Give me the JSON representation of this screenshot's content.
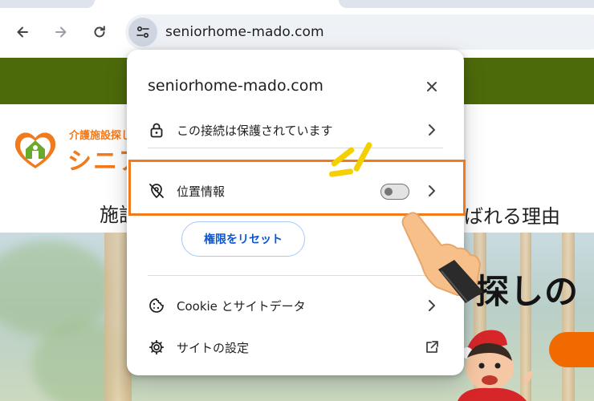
{
  "browser": {
    "url": "seniorhome-mado.com",
    "nav_icons": [
      "back-arrow-icon",
      "forward-arrow-icon",
      "reload-icon",
      "site-info-tune-icon"
    ]
  },
  "page": {
    "logo_subtitle": "介護施設探し",
    "logo_title": "シニア",
    "tagline_left": "施設",
    "tagline_right": "ばれる理由",
    "hero_heading": "探しの",
    "colors": {
      "header_green": "#4d6a0b",
      "brand_orange": "#f07a1c"
    }
  },
  "popup": {
    "title": "seniorhome-mado.com",
    "connection_label": "この接続は保護されています",
    "location_label": "位置情報",
    "location_toggle_on": false,
    "reset_button_label": "権限をリセット",
    "cookie_label": "Cookie とサイトデータ",
    "site_settings_label": "サイトの設定",
    "icons": [
      "close-icon",
      "lock-icon",
      "location-off-icon",
      "cookie-icon",
      "gear-icon",
      "open-in-new-icon",
      "chevron-right-icon"
    ]
  },
  "annotation": {
    "highlight_color": "#f07a1c",
    "burst_color": "#f5d000"
  }
}
